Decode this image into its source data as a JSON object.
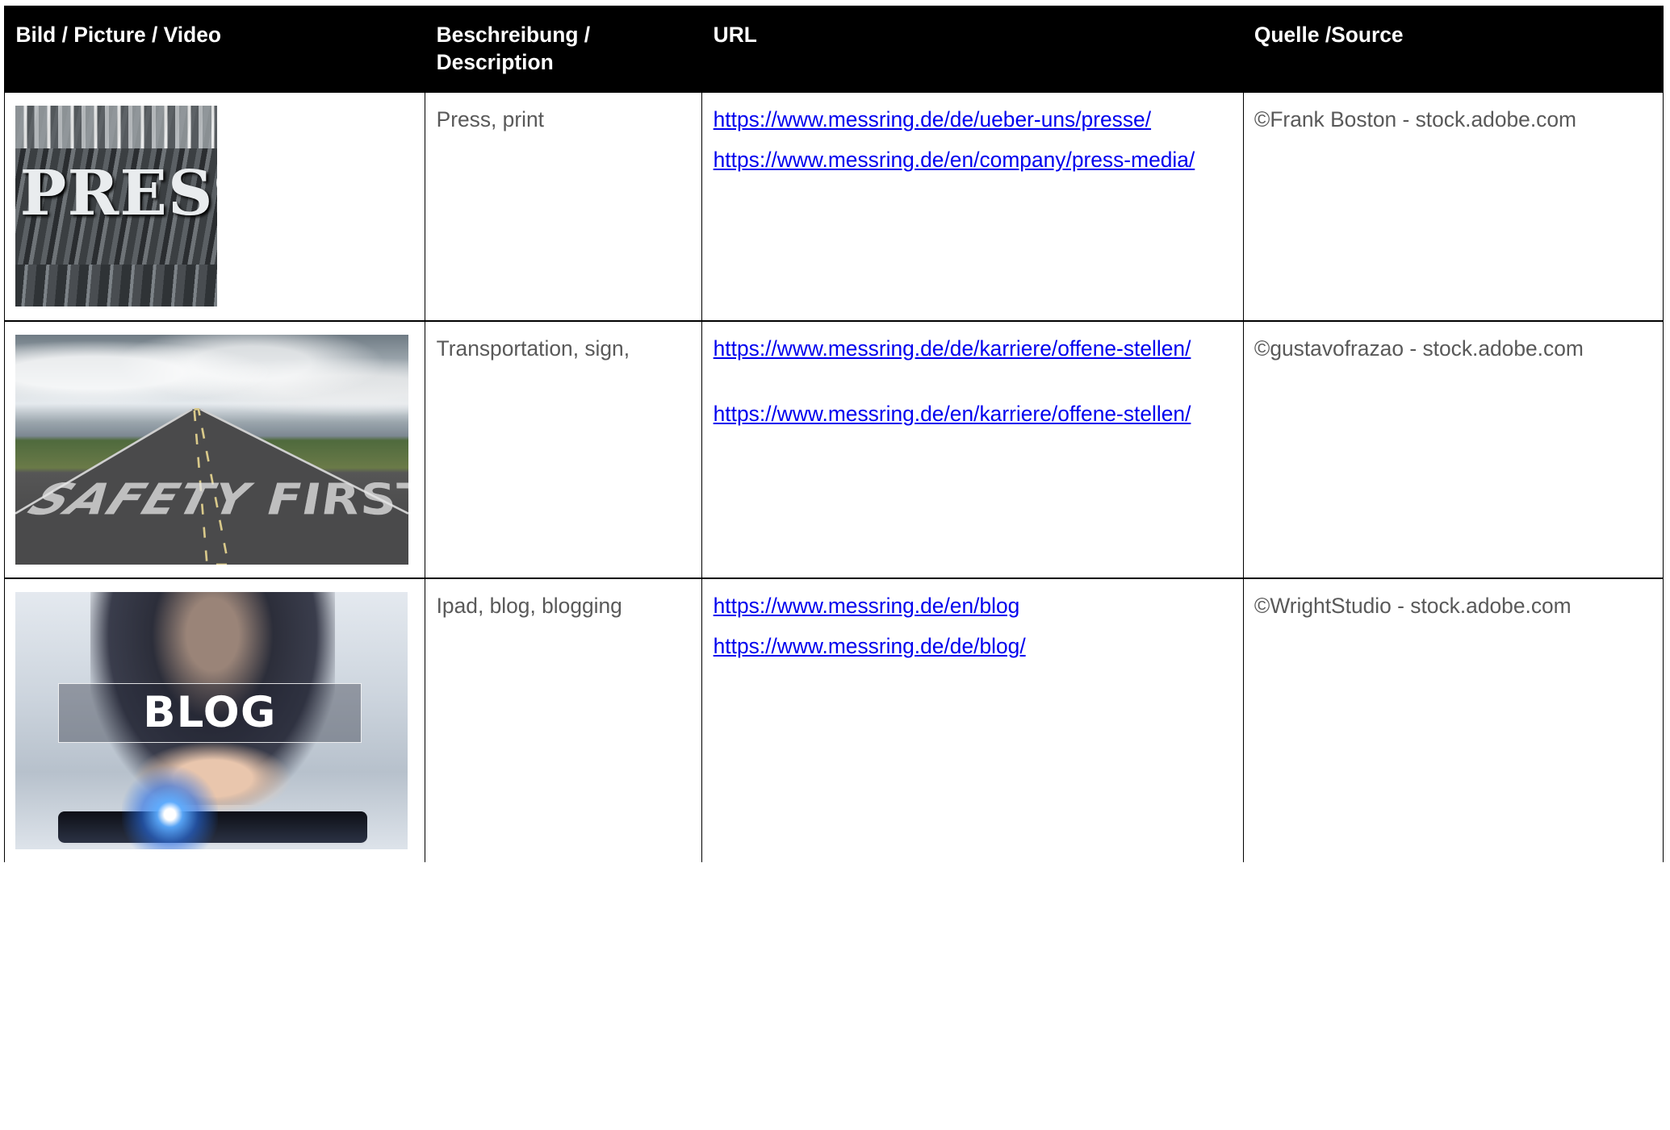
{
  "table": {
    "headers": [
      "Bild / Picture / Video",
      "Beschreibung / Description",
      "URL",
      "Quelle /Source"
    ],
    "rows": [
      {
        "image_text": "PRESS",
        "description": "Press, print",
        "urls": [
          "https://www.messring.de/de/ueber-uns/presse/",
          "https://www.messring.de/en/company/press-media/"
        ],
        "source": "©Frank Boston - stock.adobe.com"
      },
      {
        "image_text": "SAFETY FIRST",
        "description": "Transportation, sign,",
        "urls": [
          "https://www.messring.de/de/karriere/offene-stellen/",
          "https://www.messring.de/en/karriere/offene-stellen/"
        ],
        "source": "©gustavofrazao - stock.adobe.com"
      },
      {
        "image_text": "BLOG",
        "description": "Ipad, blog, blogging",
        "urls": [
          "https://www.messring.de/en/blog",
          "https://www.messring.de/de/blog/"
        ],
        "source": "©WrightStudio - stock.adobe.com"
      }
    ]
  },
  "colors": {
    "header_bg": "#000000",
    "header_text": "#ffffff",
    "body_text": "#595959",
    "link": "#0000ee"
  }
}
